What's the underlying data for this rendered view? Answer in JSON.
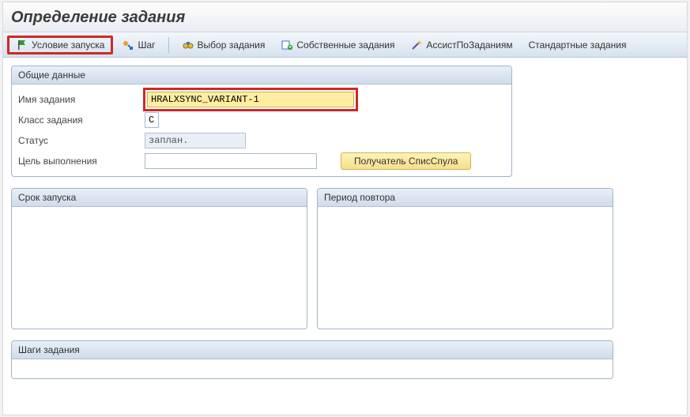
{
  "title": "Определение задания",
  "toolbar": {
    "start_condition": "Условие запуска",
    "step": "Шаг",
    "job_selection": "Выбор задания",
    "own_jobs": "Собственные задания",
    "job_wizard": "АссистПоЗаданиям",
    "standard_jobs": "Стандартные задания"
  },
  "groups": {
    "general": "Общие данные",
    "start_time": "Срок запуска",
    "repeat_period": "Период повтора",
    "job_steps": "Шаги задания"
  },
  "form": {
    "job_name_label": "Имя задания",
    "job_name_value": "HRALXSYNC_VARIANT-1",
    "job_class_label": "Класс задания",
    "job_class_value": "C",
    "status_label": "Статус",
    "status_value": "заплан.",
    "exec_target_label": "Цель выполнения",
    "exec_target_value": "",
    "spool_recipient_btn": "Получатель СписСпула"
  }
}
